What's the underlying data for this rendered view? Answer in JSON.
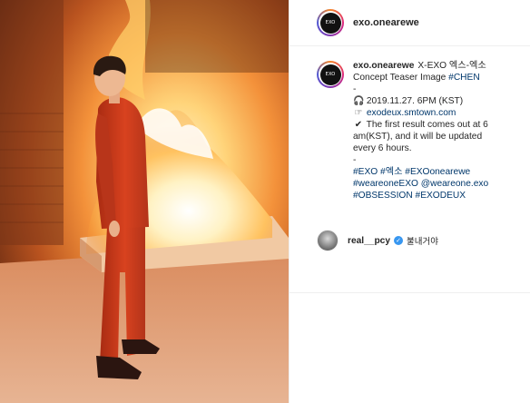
{
  "post": {
    "username": "exo.onearewe",
    "avatar_text": "EXO"
  },
  "caption": {
    "username": "exo.onearewe",
    "title_text": "X-EXO 엑스-엑소",
    "line2_text": "Concept Teaser Image",
    "line2_tag": "#CHEN",
    "sep1": "-",
    "date_icon": "headphones-icon",
    "date_text": "2019.11.27. 6PM (KST)",
    "link_icon": "pointing-hand-icon",
    "link_text": "exodeux.smtown.com",
    "check_icon": "check-mark-icon",
    "result_line1": "The first result comes out at 6",
    "result_line2": "am(KST), and it will be updated",
    "result_line3": "every 6 hours.",
    "sep2": "-",
    "tags": [
      [
        "#EXO",
        "#엑소",
        "#EXOonearewe"
      ],
      [
        "#weareoneEXO",
        "@weareone.exo"
      ],
      [
        "#OBSESSION",
        "#EXODEUX"
      ]
    ]
  },
  "comment": {
    "username": "real__pcy",
    "verified_icon": "verified-badge-icon",
    "text": "불내거야"
  },
  "colors": {
    "link": "#00376b",
    "verified": "#3897f0",
    "suit": "#c8391b",
    "fire": "#ffd27a"
  }
}
